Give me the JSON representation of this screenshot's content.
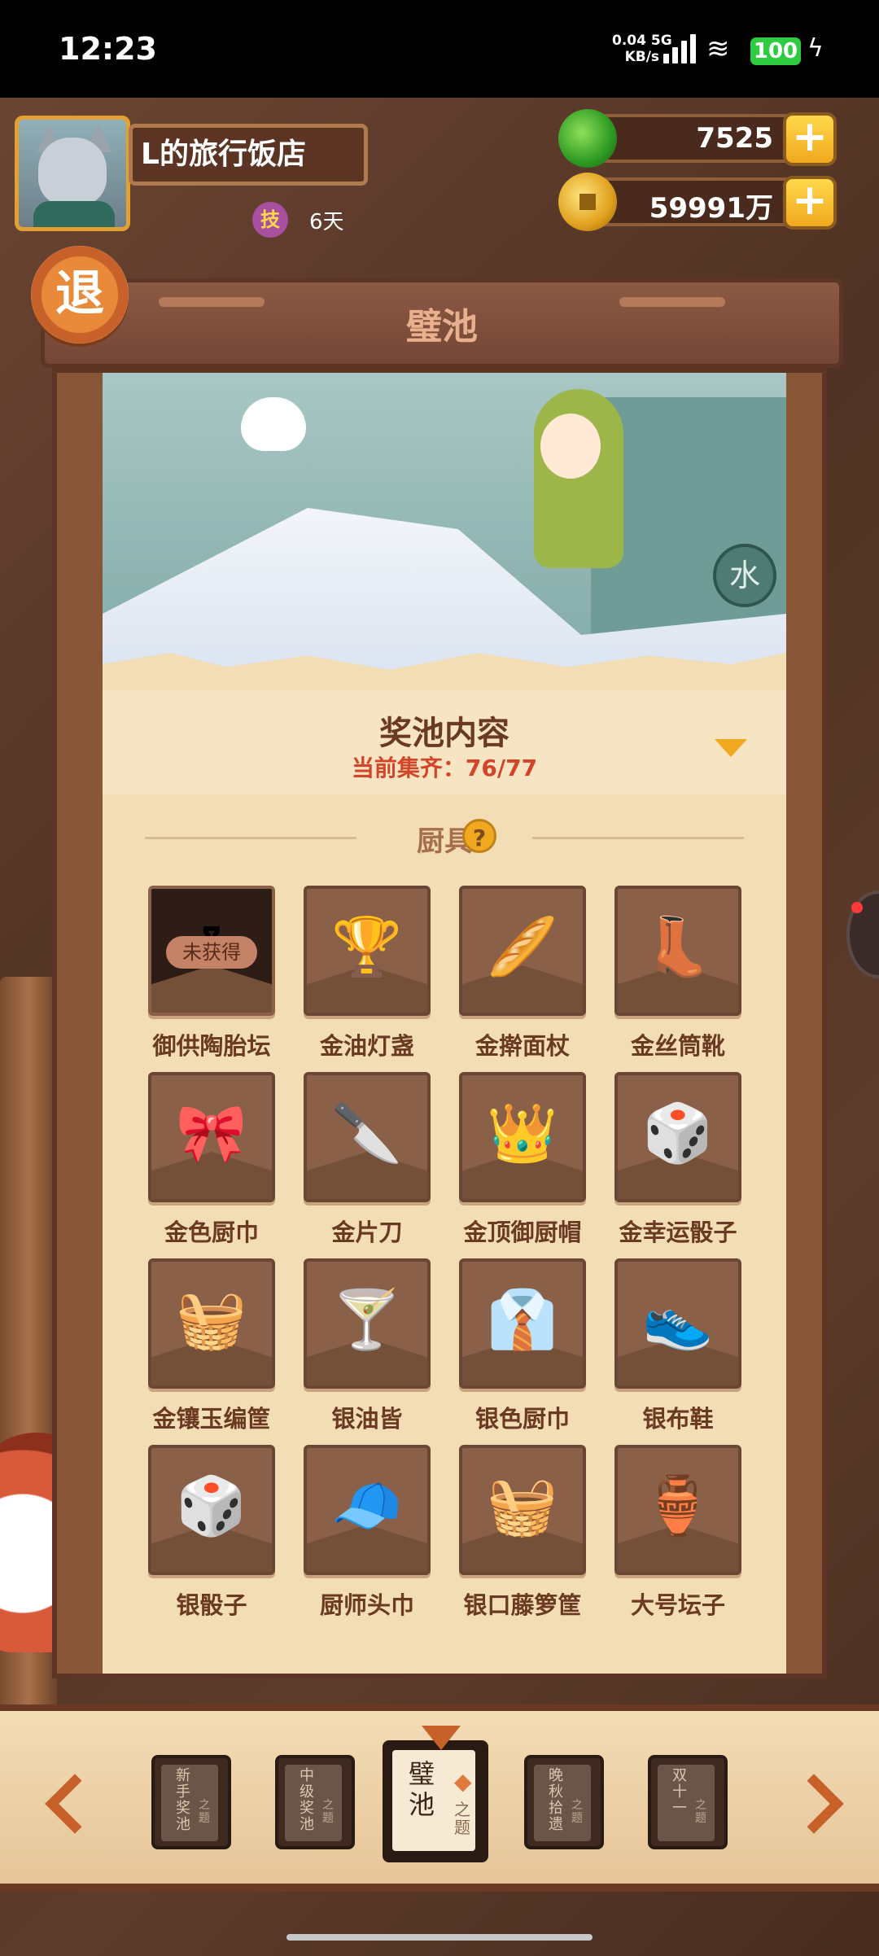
{
  "status_bar": {
    "time": "12:23",
    "net_speed_value": "0.04",
    "net_type": "5G",
    "net_speed_unit": "KB/s",
    "battery": "100"
  },
  "header": {
    "shop_name": "L的旅行饭店",
    "skill_badge": "技",
    "skill_days": "6天",
    "jade_amount": "7525",
    "coin_amount": "59991万",
    "plus": "+"
  },
  "exit_label": "退",
  "pool": {
    "title": "璧池",
    "scene_sign": "水",
    "contents_title": "奖池内容",
    "progress_text": "当前集齐：76/77",
    "category": "厨具",
    "help": "?"
  },
  "items": [
    {
      "name": "御供陶胎坛",
      "locked": true,
      "lock_text": "未获得",
      "icon": "jar-icon"
    },
    {
      "name": "金油灯盏",
      "locked": false,
      "icon": "gold-oil-lamp-icon",
      "glyph": "🏆",
      "color": "#e6a21e"
    },
    {
      "name": "金擀面杖",
      "locked": false,
      "icon": "gold-rolling-pin-icon",
      "glyph": "🥖",
      "color": "#e6a21e"
    },
    {
      "name": "金丝筒靴",
      "locked": false,
      "icon": "gold-boot-icon",
      "glyph": "👢",
      "color": "#2a3a8a"
    },
    {
      "name": "金色厨巾",
      "locked": false,
      "icon": "gold-towel-icon",
      "glyph": "🎀",
      "color": "#f0b020"
    },
    {
      "name": "金片刀",
      "locked": false,
      "icon": "gold-cleaver-icon",
      "glyph": "🔪",
      "color": "#e0c060"
    },
    {
      "name": "金顶御厨帽",
      "locked": false,
      "icon": "chef-hat-icon",
      "glyph": "👑",
      "color": "#c0301c"
    },
    {
      "name": "金幸运骰子",
      "locked": false,
      "icon": "gold-dice-icon",
      "glyph": "🎲",
      "color": "#f0c030"
    },
    {
      "name": "金镶玉编筐",
      "locked": false,
      "icon": "gold-basket-icon",
      "glyph": "🧺",
      "color": "#e0a020"
    },
    {
      "name": "银油皆",
      "locked": false,
      "icon": "silver-oil-lamp-icon",
      "glyph": "🍸",
      "color": "#d8d8d8"
    },
    {
      "name": "银色厨巾",
      "locked": false,
      "icon": "silver-towel-icon",
      "glyph": "👔",
      "color": "#e8e8e8"
    },
    {
      "name": "银布鞋",
      "locked": false,
      "icon": "silver-shoe-icon",
      "glyph": "👟",
      "color": "#5a6a9a"
    },
    {
      "name": "银骰子",
      "locked": false,
      "icon": "silver-dice-icon",
      "glyph": "🎲",
      "color": "#e8e8e8"
    },
    {
      "name": "厨师头巾",
      "locked": false,
      "icon": "headscarf-icon",
      "glyph": "🧢",
      "color": "#a8d0d8"
    },
    {
      "name": "银口藤箩筐",
      "locked": false,
      "icon": "rattan-basket-icon",
      "glyph": "🧺",
      "color": "#e0c890"
    },
    {
      "name": "大号坛子",
      "locked": false,
      "icon": "large-jar-icon",
      "glyph": "🏺",
      "color": "#6a3a1a"
    }
  ],
  "nav_books": [
    {
      "label": "新手奖池",
      "tag": "之题",
      "active": false
    },
    {
      "label": "中级奖池",
      "tag": "之题",
      "active": false
    },
    {
      "label": "璧池",
      "tag": "之题",
      "active": true
    },
    {
      "label": "晚秋拾遗",
      "tag": "之题",
      "active": false
    },
    {
      "label": "双十一",
      "tag": "之题",
      "active": false
    }
  ]
}
